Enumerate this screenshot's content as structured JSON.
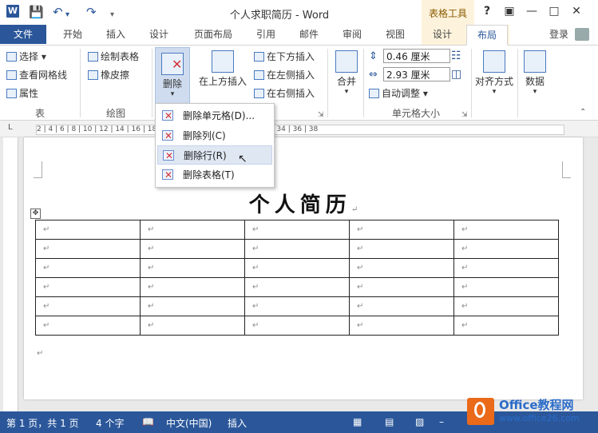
{
  "app": {
    "title": "个人求职简历 - Word",
    "context_group": "表格工具",
    "help": "?",
    "login": "登录"
  },
  "tabs": {
    "file": "文件",
    "home": "开始",
    "insert": "插入",
    "design": "设计",
    "page_layout": "页面布局",
    "references": "引用",
    "mailings": "邮件",
    "review": "审阅",
    "view": "视图",
    "table_design": "设计",
    "table_layout": "布局"
  },
  "ribbon": {
    "table": {
      "select": "选择",
      "gridlines": "查看网格线",
      "properties": "属性",
      "group": "表"
    },
    "draw": {
      "draw_table": "绘制表格",
      "eraser": "橡皮擦",
      "group": "绘图"
    },
    "rows_cols": {
      "delete": "删除",
      "insert_above": "在上方插入",
      "insert_below": "在下方插入",
      "insert_left": "在左侧插入",
      "insert_right": "在右侧插入"
    },
    "merge": {
      "merge": "合并"
    },
    "cell_size": {
      "height": "0.46 厘米",
      "width": "2.93 厘米",
      "autofit": "自动调整",
      "group": "单元格大小"
    },
    "alignment": "对齐方式",
    "data": "数据"
  },
  "delete_menu": {
    "items": [
      {
        "label": "删除单元格(D)..."
      },
      {
        "label": "删除列(C)"
      },
      {
        "label": "删除行(R)"
      },
      {
        "label": "删除表格(T)"
      }
    ]
  },
  "ruler": {
    "ticks": "2  |  4  |  6  |  8  |  10  |  12  |  14  |  16  |  18  |  20  |  22  |  24  |  26  |  28  |  30  |  32  |  34  |  36  |  38"
  },
  "document": {
    "heading": "个人简历",
    "paragraph_mark": "↵",
    "rows": 6,
    "cols": 5
  },
  "status": {
    "page": "第 1 页，共 1 页",
    "words": "4 个字",
    "language": "中文(中国)",
    "mode": "插入"
  },
  "watermark": {
    "brand": "Office教程网",
    "url": "www.office26.com"
  }
}
